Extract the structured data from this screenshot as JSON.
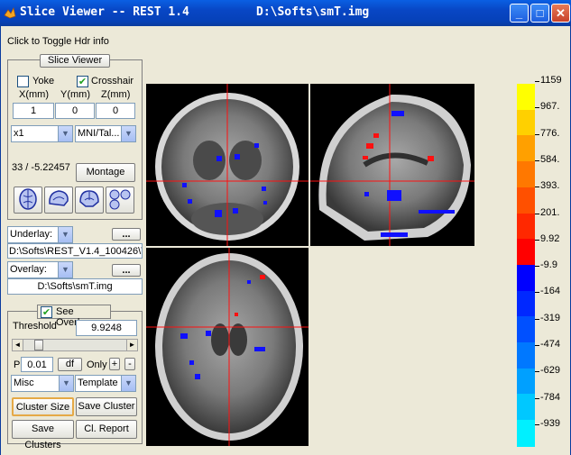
{
  "window": {
    "title": "Slice Viewer -- REST 1.4",
    "path": "D:\\Softs\\smT.img",
    "minimize": "_",
    "maximize": "□",
    "close": "✕"
  },
  "toggle_hdr": "Click to Toggle Hdr info",
  "slice_panel": {
    "title": "Slice Viewer",
    "yoke_label": "Yoke",
    "yoke_checked": false,
    "crosshair_label": "Crosshair",
    "crosshair_checked": true,
    "x_label": "X(mm)",
    "y_label": "Y(mm)",
    "z_label": "Z(mm)",
    "x_value": "1",
    "y_value": "0",
    "z_value": "0",
    "zoom": "x1",
    "template": "MNI/Tal...",
    "info": "33 / -5.22457",
    "montage": "Montage"
  },
  "underlay": {
    "label": "Underlay:",
    "browse": "...",
    "path": "D:\\Softs\\REST_V1.4_100426\\T"
  },
  "overlay": {
    "label": "Overlay:",
    "browse": "...",
    "path": "D:\\Softs\\smT.img"
  },
  "see_overlay": {
    "label": "See Overlay",
    "checked": true,
    "threshold_label": "Threshold",
    "threshold_value": "9.9248",
    "p_label": "P",
    "p_value": "0.01",
    "df": "df",
    "only_label": "Only",
    "plus": "+",
    "minus": "-",
    "misc": "Misc",
    "template_select": "Template",
    "cluster_size": "Cluster Size",
    "save_cluster": "Save Cluster",
    "save_clusters": "Save Clusters",
    "cl_report": "Cl. Report",
    "slider_level": 0.12
  },
  "colorbar": {
    "labels": [
      "1159",
      "967.",
      "776.",
      "584.",
      "393.",
      "201.",
      "9.92",
      "-9.9",
      "-164",
      "-319",
      "-474",
      "-629",
      "-784",
      "-939"
    ],
    "colors": [
      "#FFFF00",
      "#FFD000",
      "#FFA000",
      "#FF7800",
      "#FF5000",
      "#FF2800",
      "#FF0000",
      "#0000FF",
      "#0028FF",
      "#0050FF",
      "#0078FF",
      "#00A0FF",
      "#00C8FF",
      "#00F0FF"
    ]
  }
}
